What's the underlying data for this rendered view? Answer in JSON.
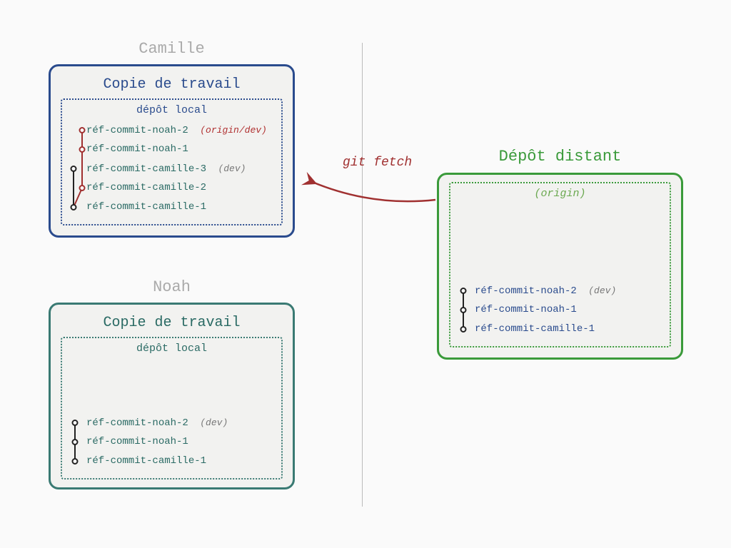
{
  "titles": {
    "camille": "Camille",
    "noah": "Noah",
    "remote": "Dépôt distant"
  },
  "panels": {
    "camille": {
      "title": "Copie de travail",
      "inner_title": "dépôt local",
      "commits": [
        {
          "ref": "réf-commit-noah-2",
          "tag": "(origin/dev)",
          "tag_color": "red"
        },
        {
          "ref": "réf-commit-noah-1",
          "tag": "",
          "tag_color": ""
        },
        {
          "ref": "réf-commit-camille-3",
          "tag": "(dev)",
          "tag_color": "grey"
        },
        {
          "ref": "réf-commit-camille-2",
          "tag": "",
          "tag_color": ""
        },
        {
          "ref": "réf-commit-camille-1",
          "tag": "",
          "tag_color": ""
        }
      ]
    },
    "noah": {
      "title": "Copie de travail",
      "inner_title": "dépôt local",
      "commits": [
        {
          "ref": "réf-commit-noah-2",
          "tag": "(dev)",
          "tag_color": "grey"
        },
        {
          "ref": "réf-commit-noah-1",
          "tag": "",
          "tag_color": ""
        },
        {
          "ref": "réf-commit-camille-1",
          "tag": "",
          "tag_color": ""
        }
      ]
    },
    "remote": {
      "title": "(origin)",
      "commits": [
        {
          "ref": "réf-commit-noah-2",
          "tag": "(dev)",
          "tag_color": "grey"
        },
        {
          "ref": "réf-commit-noah-1",
          "tag": "",
          "tag_color": ""
        },
        {
          "ref": "réf-commit-camille-1",
          "tag": "",
          "tag_color": ""
        }
      ]
    }
  },
  "arrow_label": "git fetch"
}
